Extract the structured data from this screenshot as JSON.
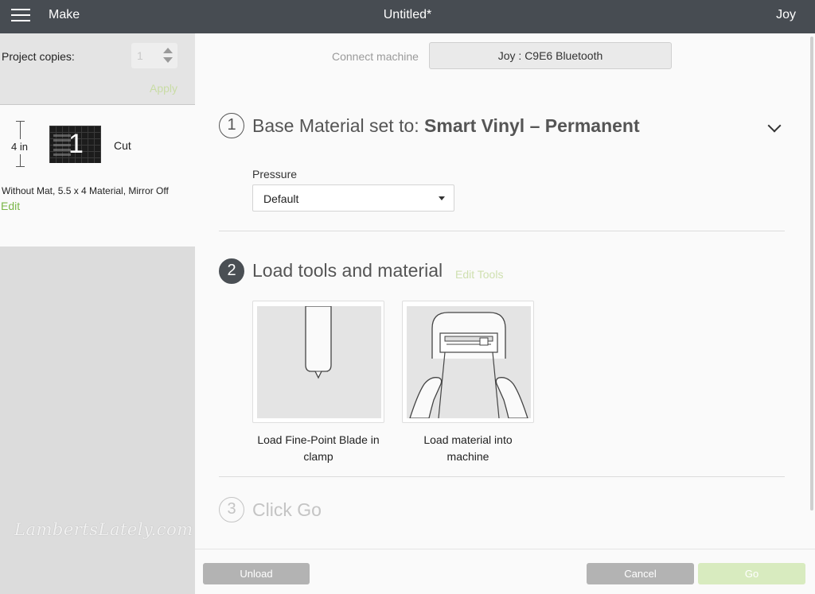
{
  "header": {
    "app_name": "Make",
    "doc_title": "Untitled*",
    "user": "Joy"
  },
  "left_panel": {
    "copies_label": "Project copies:",
    "copies_value": "1",
    "apply_label": "Apply",
    "mat": {
      "dimension": "4 in",
      "mat_number": "1",
      "operation": "Cut",
      "info": "Without Mat, 5.5 x 4 Material, Mirror Off",
      "edit_label": "Edit"
    }
  },
  "watermark": "LambertsLately.com",
  "connect": {
    "label": "Connect machine",
    "machine": "Joy : C9E6 Bluetooth"
  },
  "step1": {
    "number": "1",
    "title_prefix": "Base Material set to: ",
    "material": "Smart Vinyl – Permanent",
    "pressure_label": "Pressure",
    "pressure_value": "Default"
  },
  "step2": {
    "number": "2",
    "title": "Load tools and material",
    "edit_tools_label": "Edit Tools",
    "cards": [
      {
        "icon": "fine-point-blade",
        "caption": "Load Fine-Point Blade in clamp"
      },
      {
        "icon": "load-material",
        "caption": "Load material into machine"
      }
    ]
  },
  "step3": {
    "number": "3",
    "title": "Click Go"
  },
  "footer": {
    "unload_label": "Unload",
    "cancel_label": "Cancel",
    "go_label": "Go"
  },
  "colors": {
    "header_bg": "#474c52",
    "accent_green": "#7ab648",
    "disabled_green": "#d8ebbf",
    "button_gray": "#b3b3b3"
  }
}
